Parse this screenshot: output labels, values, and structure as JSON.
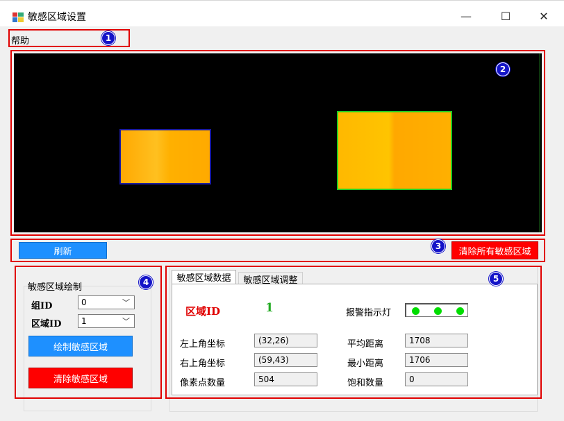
{
  "window": {
    "title": "敏感区域设置",
    "minimize_glyph": "—",
    "maximize_glyph": "☐",
    "close_glyph": "✕"
  },
  "menu": {
    "help": "帮助"
  },
  "badges": [
    "1",
    "2",
    "3",
    "4",
    "5"
  ],
  "toolbar": {
    "refresh_label": "刷新",
    "clear_all_label": "清除所有敏感区域"
  },
  "draw_panel": {
    "group_title": "敏感区域绘制",
    "group_id_label": "组ID",
    "group_id_value": "0",
    "region_id_label": "区域ID",
    "region_id_value": "1",
    "draw_button": "绘制敏感区域",
    "clear_button": "清除敏感区域"
  },
  "tabs": [
    {
      "label": "敏感区域数据"
    },
    {
      "label": "敏感区域调整"
    }
  ],
  "data_panel": {
    "region_id_label": "区域ID",
    "region_id_value": "1",
    "alarm_label": "报警指示灯",
    "top_left_label": "左上角坐标",
    "top_left_value": "(32,26)",
    "top_right_label": "右上角坐标",
    "top_right_value": "(59,43)",
    "pixel_count_label": "像素点数量",
    "pixel_count_value": "504",
    "avg_distance_label": "平均距离",
    "avg_distance_value": "1708",
    "min_distance_label": "最小距离",
    "min_distance_value": "1706",
    "saturation_label": "饱和数量",
    "saturation_value": "0"
  },
  "colors": {
    "annotation_red": "#e00000",
    "badge_blue": "#1414c8",
    "button_blue": "#1e90ff",
    "button_red": "#ff0000",
    "region_id_red": "#e00000",
    "region_id_value_green": "#22aa22",
    "region1_border": "#1a1aa0",
    "region2_border": "#22cc22",
    "region_fill": "#ffb300",
    "led_green": "#00dd00"
  }
}
